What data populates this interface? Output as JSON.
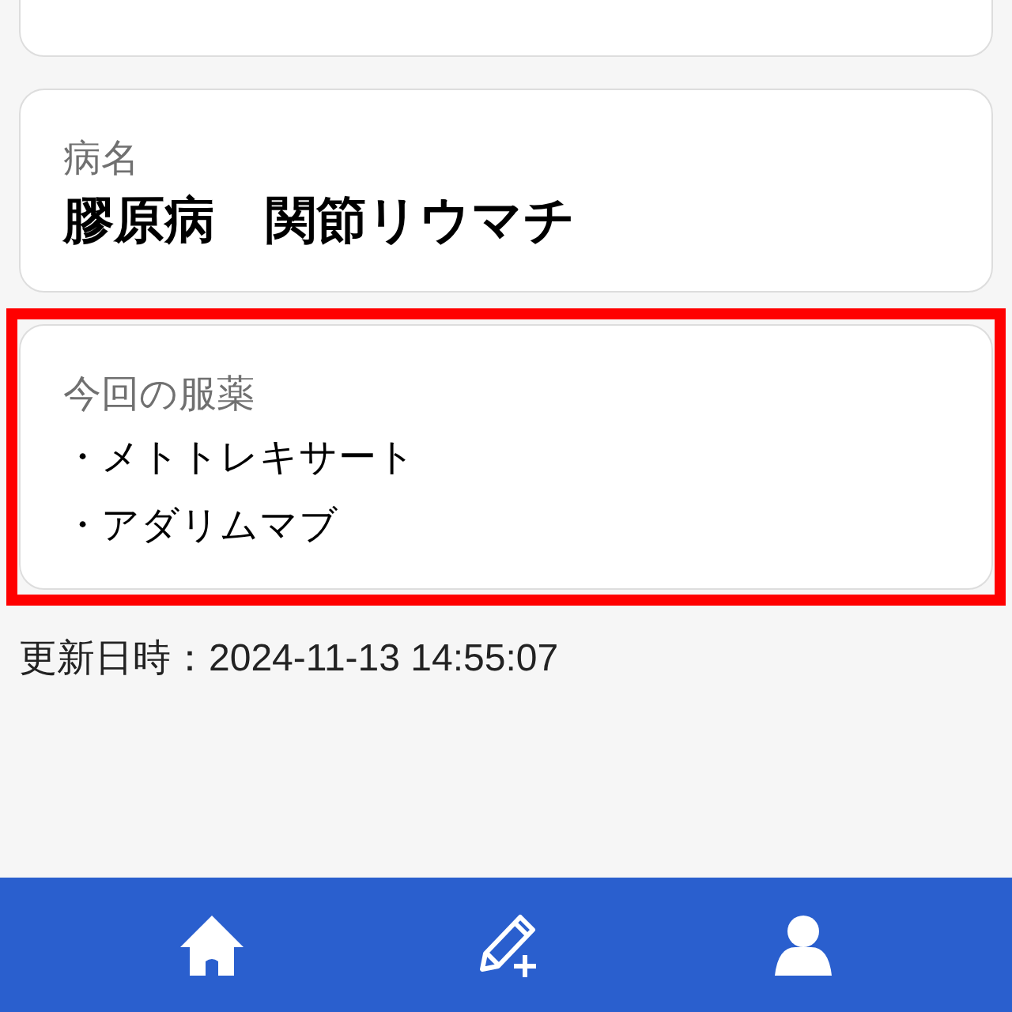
{
  "disease_card": {
    "label": "病名",
    "value": "膠原病　関節リウマチ"
  },
  "medication_card": {
    "label": "今回の服薬",
    "highlighted": true,
    "items": [
      "・メトトレキサート",
      "・アダリムマブ"
    ]
  },
  "updated": "更新日時：2024-11-13 14:55:07",
  "bottom_nav": [
    {
      "kind": "home"
    },
    {
      "kind": "edit"
    },
    {
      "kind": "profile"
    }
  ]
}
